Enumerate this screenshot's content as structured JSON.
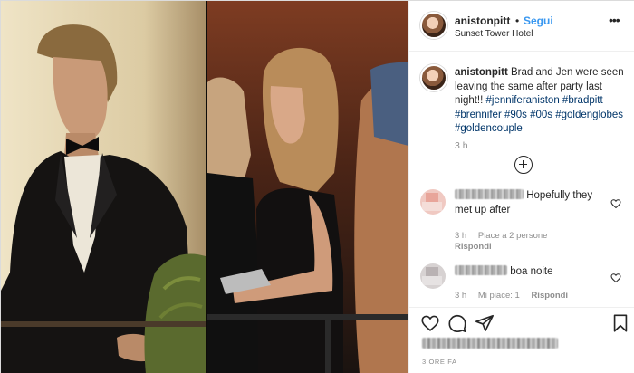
{
  "post": {
    "username": "anistonpitt",
    "separator": "•",
    "follow_label": "Segui",
    "location": "Sunset Tower Hotel",
    "more_icon": "more-horizontal-icon"
  },
  "caption": {
    "username": "anistonpitt",
    "text": "Brad and Jen were seen leaving the same after party last night!!",
    "hashtags": "#jenniferaniston #bradpitt #brennifer #90s #00s #goldenglobes #goldencouple",
    "time": "3 h"
  },
  "comments": [
    {
      "username": "andreadamo___",
      "text": "Hopefully they met up after",
      "time": "3 h",
      "likes": "Piace a 2 persone",
      "reply": "Rispondi"
    },
    {
      "username": "________",
      "text": "boa noite",
      "time": "3 h",
      "likes": "Mi piace: 1",
      "reply": "Rispondi"
    }
  ],
  "actions": {
    "like_icon": "heart-icon",
    "comment_icon": "comment-icon",
    "share_icon": "paper-plane-icon",
    "save_icon": "bookmark-icon"
  },
  "footer": {
    "time_ago": "3 ORE FA"
  },
  "colors": {
    "link": "#3897f0",
    "hashtag": "#003569",
    "muted": "#8e8e8e",
    "text": "#262626",
    "border": "#efefef"
  }
}
